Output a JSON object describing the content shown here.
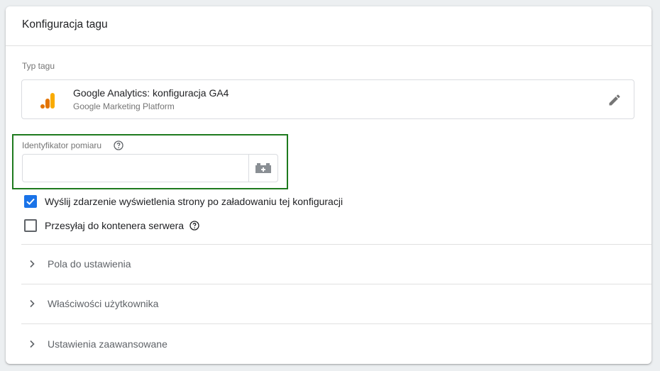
{
  "card": {
    "title": "Konfiguracja tagu"
  },
  "tag_type": {
    "section_label": "Typ tagu",
    "name": "Google Analytics: konfiguracja GA4",
    "vendor": "Google Marketing Platform",
    "logo_icon": "google-analytics-icon",
    "edit_icon": "pencil-icon"
  },
  "measurement_id": {
    "label": "Identyfikator pomiaru",
    "value": "",
    "placeholder": "",
    "help_icon": "question-circle-icon",
    "variable_icon": "variable-brick-icon"
  },
  "checkboxes": [
    {
      "label": "Wyślij zdarzenie wyświetlenia strony po załadowaniu tej konfiguracji",
      "checked": true
    },
    {
      "label": "Przesyłaj do kontenera serwera",
      "checked": false,
      "help_icon": "question-circle-icon"
    }
  ],
  "sections": [
    {
      "label": "Pola do ustawienia"
    },
    {
      "label": "Właściwości użytkownika"
    },
    {
      "label": "Ustawienia zaawansowane"
    }
  ],
  "colors": {
    "accent": "#1a73e8",
    "highlight_border": "#1e7a1e",
    "ga_orange": "#f9ab00",
    "ga_dark_orange": "#e37400"
  }
}
